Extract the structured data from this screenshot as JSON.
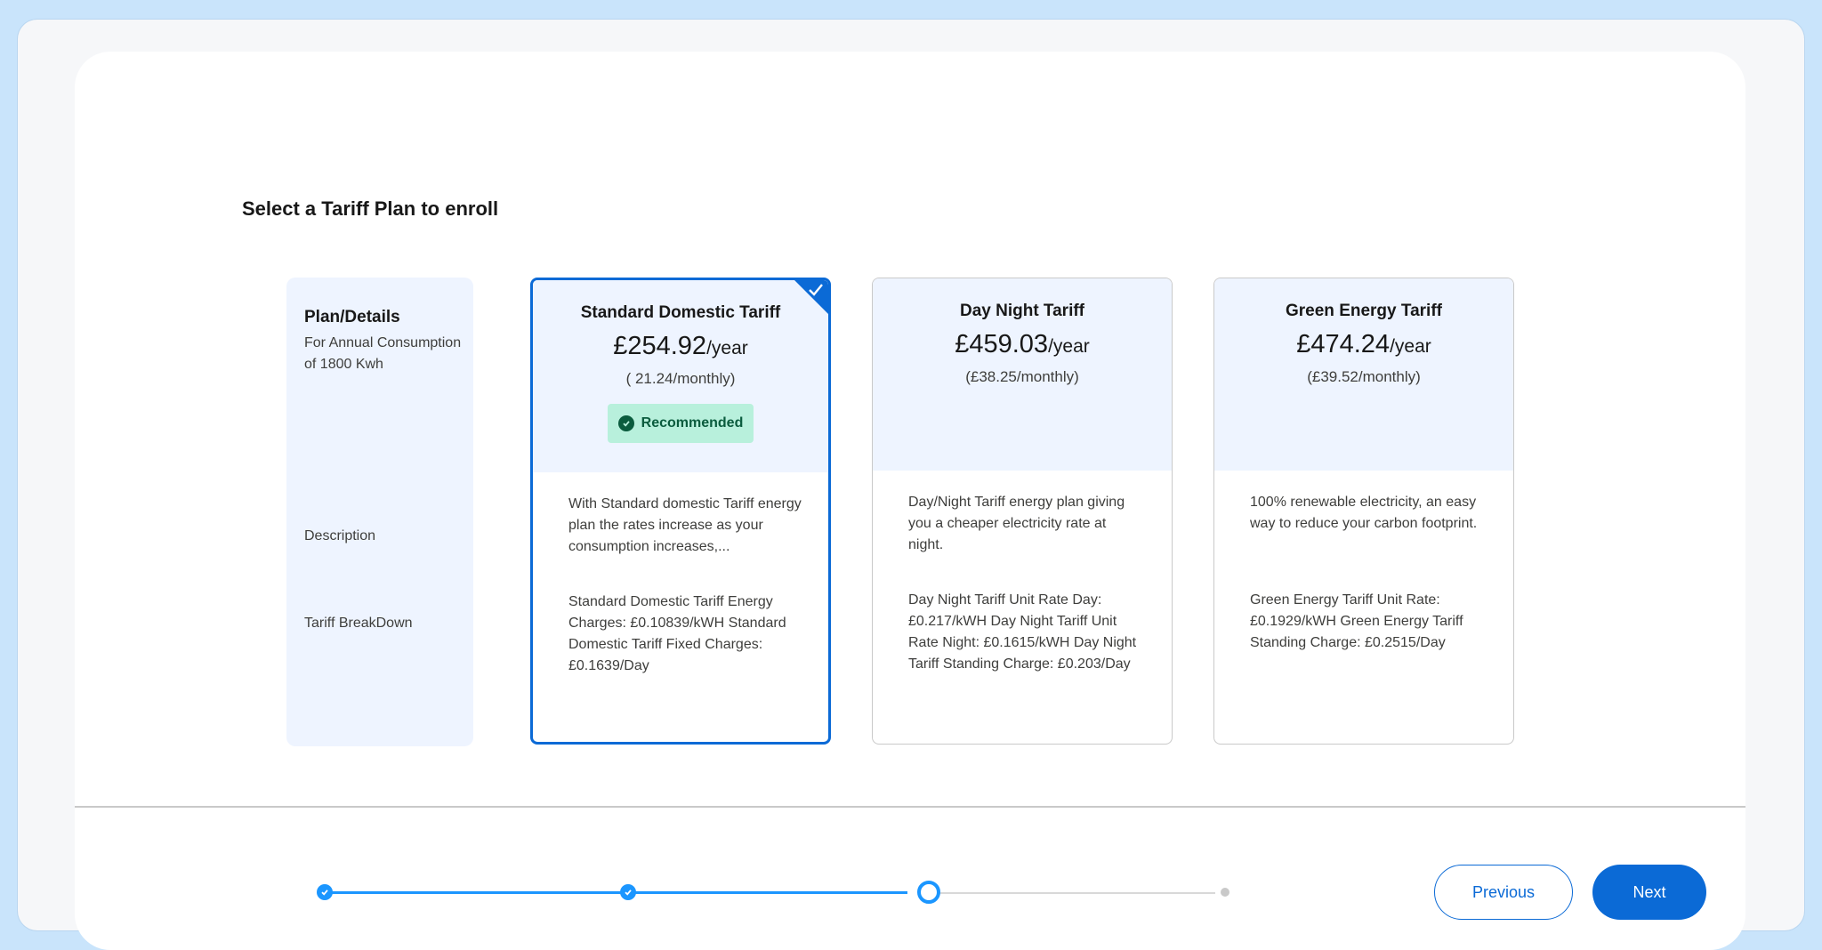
{
  "page": {
    "title": "Select a Tariff Plan to enroll"
  },
  "labels": {
    "plan_details": "Plan/Details",
    "consumption_note": "For Annual Consumption of 1800 Kwh",
    "description": "Description",
    "breakdown": "Tariff BreakDown"
  },
  "plans": [
    {
      "name": "Standard Domestic Tariff",
      "price": "£254.92",
      "per": "/year",
      "monthly": "(  21.24/monthly)",
      "badge": "Recommended",
      "selected": true,
      "description": "With Standard domestic Tariff energy plan the rates increase as your consumption increases,...",
      "breakdown": "Standard Domestic Tariff Energy Charges: £0.10839/kWH Standard Domestic Tariff Fixed Charges: £0.1639/Day"
    },
    {
      "name": "Day Night Tariff",
      "price": "£459.03",
      "per": "/year",
      "monthly": "(£38.25/monthly)",
      "selected": false,
      "description": "Day/Night Tariff energy plan giving you a cheaper electricity rate at night.",
      "breakdown": "Day Night Tariff Unit Rate Day: £0.217/kWH Day Night Tariff Unit Rate Night: £0.1615/kWH Day Night Tariff Standing Charge: £0.203/Day"
    },
    {
      "name": "Green Energy Tariff",
      "price": "£474.24",
      "per": "/year",
      "monthly": "(£39.52/monthly)",
      "selected": false,
      "description": "100% renewable electricity, an easy way to reduce your carbon footprint.",
      "breakdown": "Green Energy Tariff Unit Rate: £0.1929/kWH Green Energy Tariff Standing Charge: £0.2515/Day"
    }
  ],
  "progress": {
    "steps_total": 4,
    "current_step": 3
  },
  "buttons": {
    "previous": "Previous",
    "next": "Next"
  },
  "colors": {
    "brand": "#0b6ad6",
    "progress": "#1b96ff",
    "badge_bg": "#b8f0dc",
    "header_bg": "#eef4ff"
  }
}
